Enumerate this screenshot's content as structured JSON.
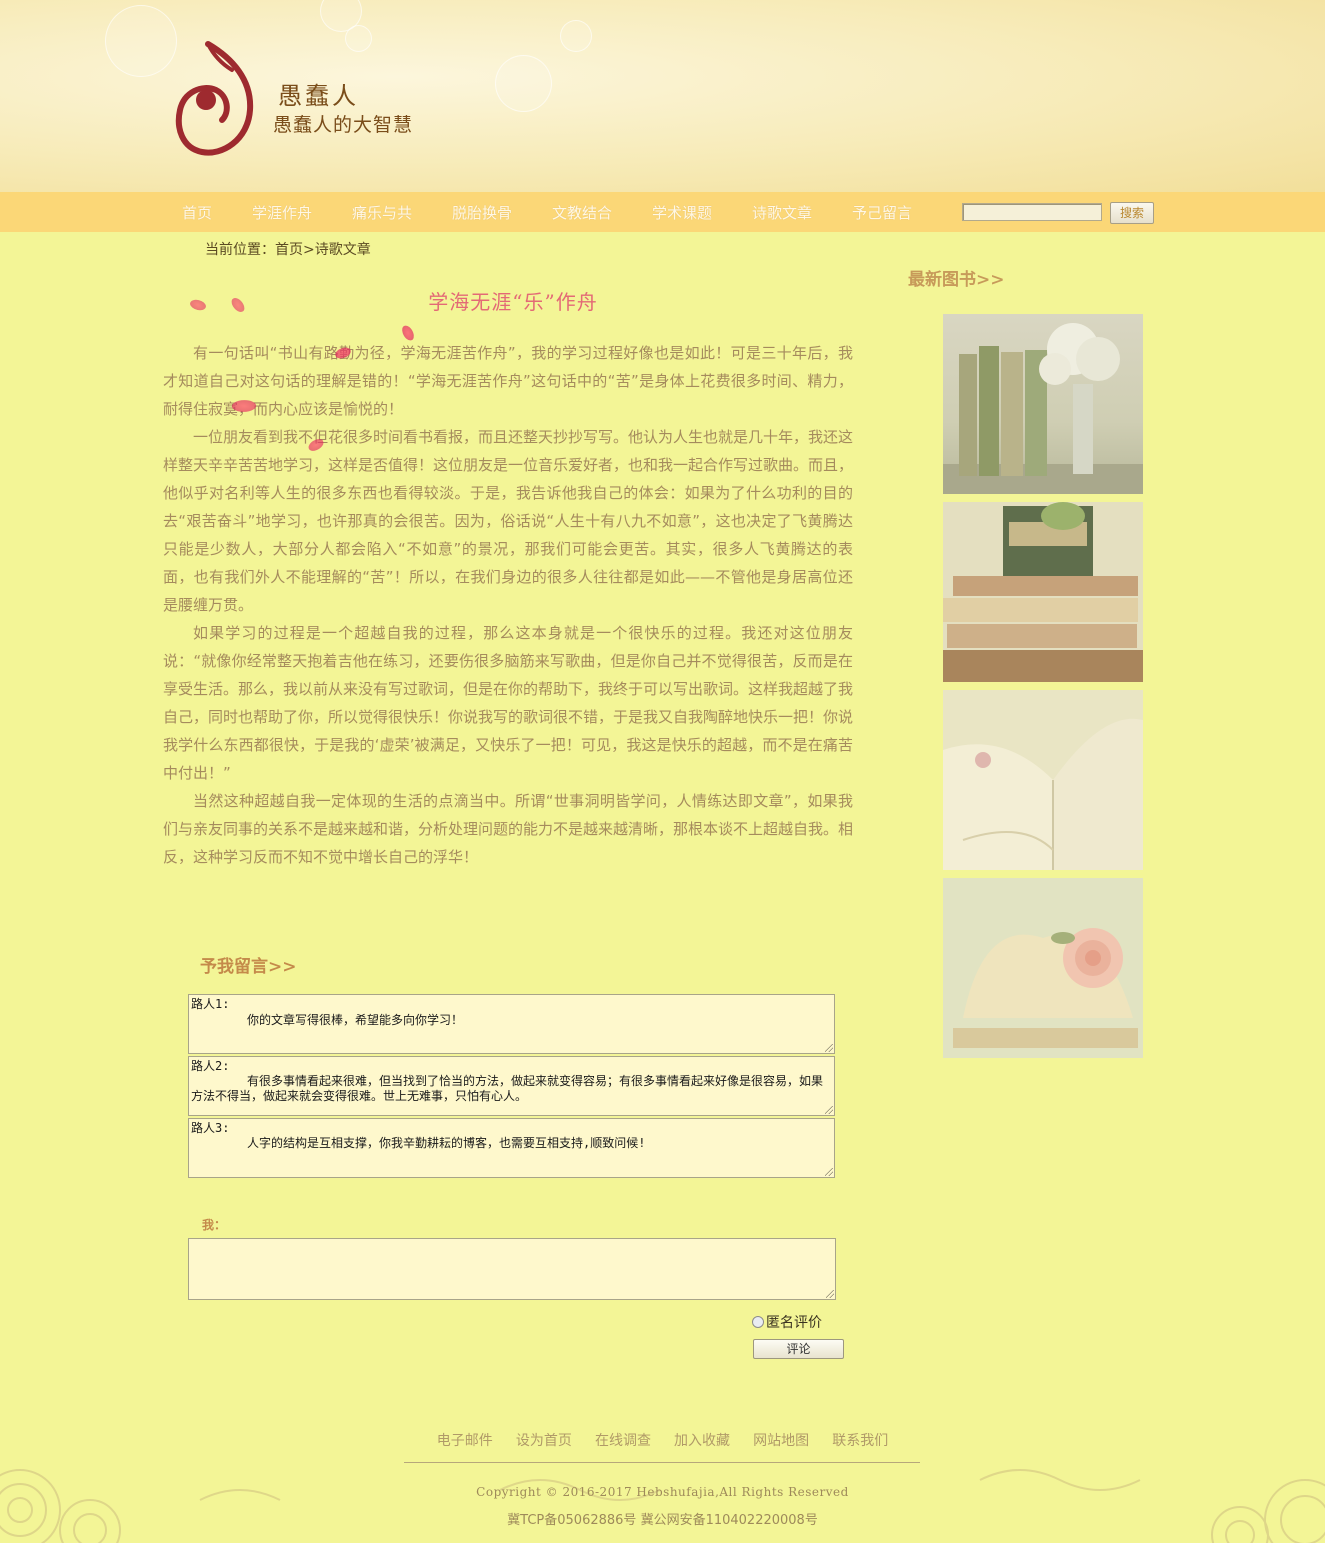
{
  "brand": {
    "title": "愚蠢人",
    "subtitle": "愚蠢人的大智慧"
  },
  "nav": {
    "items": [
      "首页",
      "学涯作舟",
      "痛乐与共",
      "脱胎换骨",
      "文教结合",
      "学术课题",
      "诗歌文章",
      "予己留言"
    ],
    "search_placeholder": "",
    "search_button": "搜索"
  },
  "breadcrumb": {
    "prefix": "当前位置：",
    "home": "首页",
    "separator": ">",
    "current": "诗歌文章"
  },
  "article": {
    "title": "学海无涯“乐”作舟",
    "paragraphs": [
      "有一句话叫“书山有路勤为径，学海无涯苦作舟”，我的学习过程好像也是如此！可是三十年后，我才知道自己对这句话的理解是错的！“学海无涯苦作舟”这句话中的“苦”是身体上花费很多时间、精力，耐得住寂寞，而内心应该是愉悦的！",
      "一位朋友看到我不但花很多时间看书看报，而且还整天抄抄写写。他认为人生也就是几十年，我还这样整天辛辛苦苦地学习，这样是否值得！这位朋友是一位音乐爱好者，也和我一起合作写过歌曲。而且，他似乎对名利等人生的很多东西也看得较淡。于是，我告诉他我自己的体会：如果为了什么功利的目的去“艰苦奋斗”地学习，也许那真的会很苦。因为，俗话说“人生十有八九不如意”，这也决定了飞黄腾达只能是少数人，大部分人都会陷入“不如意”的景况，那我们可能会更苦。其实，很多人飞黄腾达的表面，也有我们外人不能理解的“苦”！所以，在我们身边的很多人往往都是如此——不管他是身居高位还是腰缠万贯。",
      "如果学习的过程是一个超越自我的过程，那么这本身就是一个很快乐的过程。我还对这位朋友说：“就像你经常整天抱着吉他在练习，还要伤很多脑筋来写歌曲，但是你自己并不觉得很苦，反而是在享受生活。那么，我以前从来没有写过歌词，但是在你的帮助下，我终于可以写出歌词。这样我超越了我自己，同时也帮助了你，所以觉得很快乐！你说我写的歌词很不错，于是我又自我陶醉地快乐一把！你说我学什么东西都很快，于是我的‘虚荣’被满足，又快乐了一把！可见，我这是快乐的超越，而不是在痛苦中付出！”",
      "当然这种超越自我一定体现的生活的点滴当中。所谓“世事洞明皆学问，人情练达即文章”，如果我们与亲友同事的关系不是越来越和谐，分析处理问题的能力不是越来越清晰，那根本谈不上超越自我。相反，这种学习反而不知不觉中增长自己的浮华！"
    ]
  },
  "sidebar": {
    "title": "最新图书>>"
  },
  "comments": {
    "title": "予我留言>>",
    "items": [
      {
        "author": "路人1:",
        "text": "你的文章写得很棒，希望能多向你学习！"
      },
      {
        "author": "路人2:",
        "text": "有很多事情看起来很难，但当找到了恰当的方法，做起来就变得容易；有很多事情看起来好像是很容易，如果方法不得当，做起来就会变得很难。世上无难事，只怕有心人。"
      },
      {
        "author": "路人3:",
        "text": "人字的结构是互相支撑，你我辛勤耕耘的博客，也需要互相支持,顺致问候!"
      }
    ],
    "me_label": "我：",
    "anonymous_label": "匿名评价",
    "submit_label": "评论"
  },
  "footer": {
    "links": [
      "电子邮件",
      "设为首页",
      "在线调查",
      "加入收藏",
      "网站地图",
      "联系我们"
    ],
    "copyright": "Copyright © 2016-2017 Hebshufajia,All Rights Reserved",
    "icp": "冀TCP备05062886号 冀公网安备110402220008号"
  },
  "colors": {
    "page_bg": "#f3f596",
    "nav_bg": "#fbd777",
    "title_pink": "#e36a76",
    "body_text": "#a58b5d",
    "accent_brown": "#c48a4a"
  }
}
